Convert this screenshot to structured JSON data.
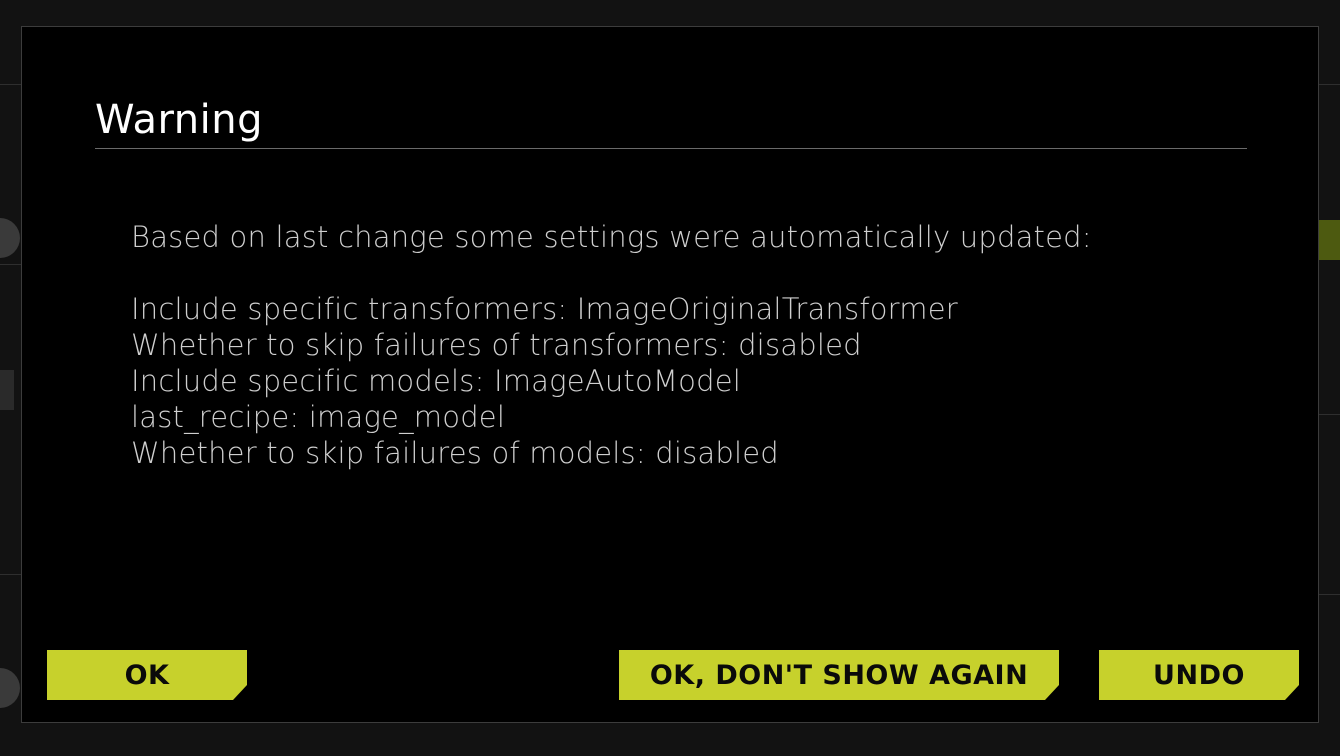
{
  "modal": {
    "title": "Warning",
    "intro": "Based on last change some settings were automatically updated:",
    "changes": [
      "Include specific transformers: ImageOriginalTransformer",
      "Whether to skip failures of transformers: disabled",
      "Include specific models: ImageAutoModel",
      "last_recipe: image_model",
      "Whether to skip failures of models: disabled"
    ],
    "buttons": {
      "ok_label": "OK",
      "dont_show_label": "OK, DON'T SHOW AGAIN",
      "undo_label": "UNDO"
    }
  },
  "colors": {
    "button_accent": "#c7d12c",
    "modal_background": "#000000",
    "title_text": "#ffffff",
    "body_text": "#cfcfcf"
  }
}
